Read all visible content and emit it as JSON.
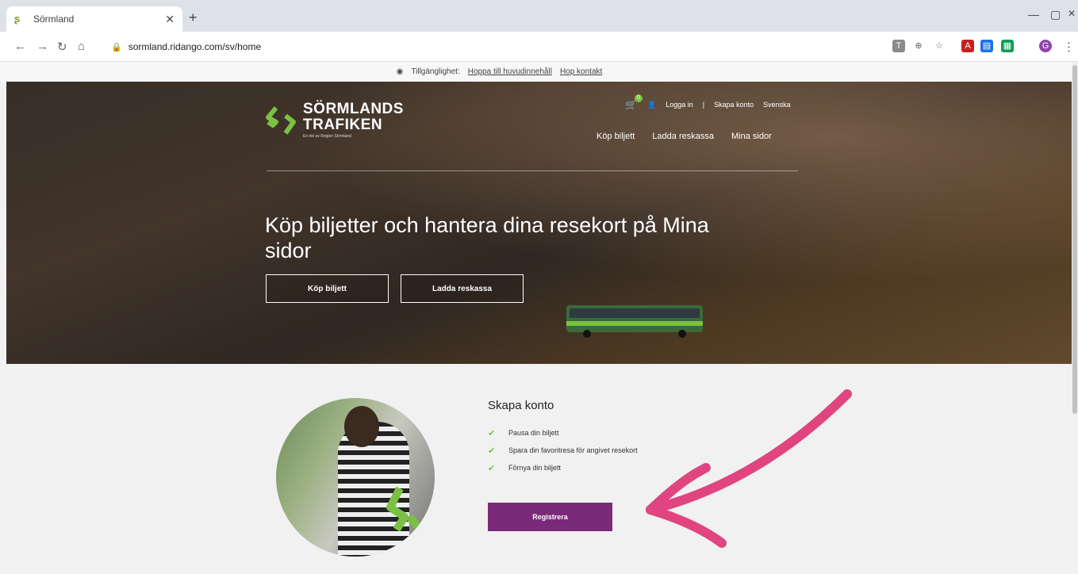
{
  "browser": {
    "tab_title": "Sörmland",
    "tab_favicon": "S-logo",
    "url": "sormland.ridango.com/sv/home"
  },
  "a11y": {
    "label": "Tillgänglighet:",
    "skip_main": "Hoppa till huvudinnehåll",
    "skip_contact": "Hop kontakt"
  },
  "brand": {
    "line1": "SÖRMLANDS",
    "line2": "TRAFIKEN",
    "tagline": "En del av Region Sörmland",
    "green": "#7ac143",
    "purple": "#7a2a78"
  },
  "header": {
    "cart_count": "0",
    "login": "Logga in",
    "separator": "|",
    "create_account": "Skapa konto",
    "language": "Svenska",
    "nav": [
      "Köp biljett",
      "Ladda reskassa",
      "Mina sidor"
    ]
  },
  "hero": {
    "headline": "Köp biljetter och hantera dina resekort på Mina sidor",
    "btn_buy": "Köp biljett",
    "btn_load": "Ladda reskassa"
  },
  "signup": {
    "title": "Skapa konto",
    "benefits": [
      "Pausa din biljett",
      "Spara din favoritresa för angivet resekort",
      "Förnya din biljett"
    ],
    "register": "Registrera"
  },
  "annotation": {
    "arrow_color": "#e0457f"
  }
}
